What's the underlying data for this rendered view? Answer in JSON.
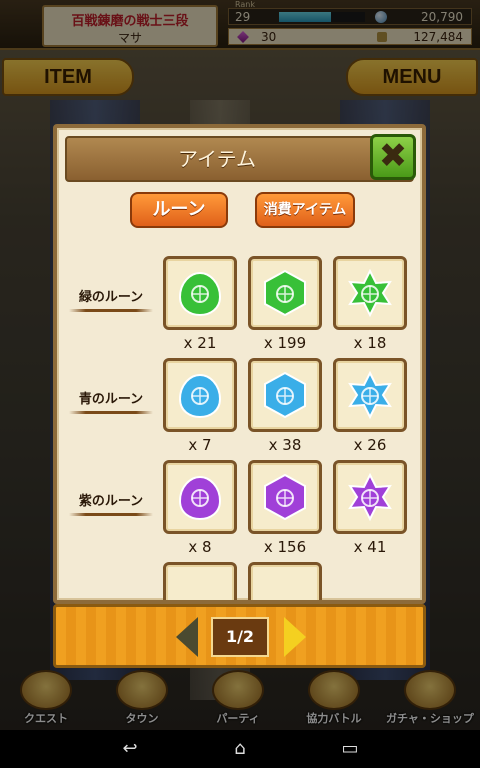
{
  "header": {
    "rank_title": "百戦錬磨の戦士三段",
    "player_name": "マサ",
    "rank_label": "Rank",
    "rank": "29",
    "rank_progress": 0.6,
    "coins": "20,790",
    "gems": "30",
    "money": "127,484"
  },
  "tabs": {
    "item": "ITEM",
    "menu": "MENU"
  },
  "dialog": {
    "title": "アイテム",
    "close_icon": "close-x-icon",
    "categories": [
      "ルーン",
      "消費アイテム"
    ],
    "rows": [
      {
        "label": "緑のルーン",
        "color": "#38c038",
        "items": [
          {
            "shape": "droplet",
            "qty": "x 21"
          },
          {
            "shape": "hexagon",
            "qty": "x 199"
          },
          {
            "shape": "star",
            "qty": "x 18"
          }
        ]
      },
      {
        "label": "青のルーン",
        "color": "#3aaee8",
        "items": [
          {
            "shape": "droplet",
            "qty": "x 7"
          },
          {
            "shape": "hexagon",
            "qty": "x 38"
          },
          {
            "shape": "star",
            "qty": "x 26"
          }
        ]
      },
      {
        "label": "紫のルーン",
        "color": "#a040d8",
        "items": [
          {
            "shape": "droplet",
            "qty": "x 8"
          },
          {
            "shape": "hexagon",
            "qty": "x 156"
          },
          {
            "shape": "star",
            "qty": "x 41"
          }
        ]
      }
    ],
    "page": "1/2"
  },
  "bottom_nav": [
    "クエスト",
    "タウン",
    "パーティ",
    "協力バトル",
    "ガチャ・ショップ"
  ]
}
